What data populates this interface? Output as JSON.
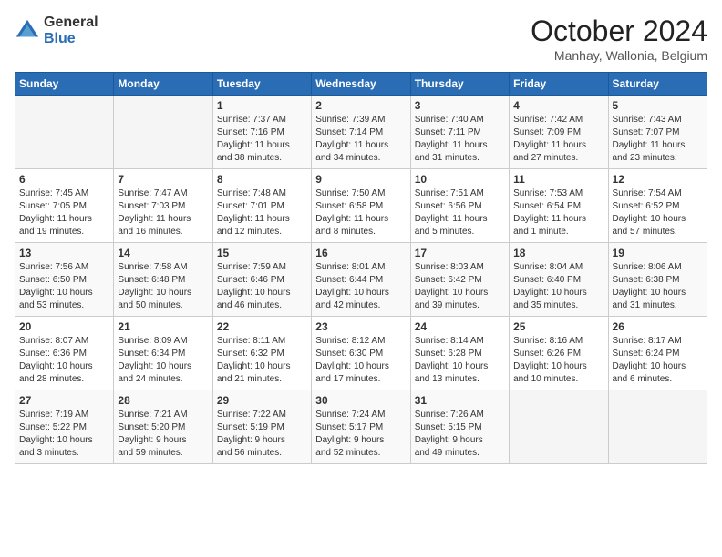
{
  "header": {
    "logo_general": "General",
    "logo_blue": "Blue",
    "title": "October 2024",
    "location": "Manhay, Wallonia, Belgium"
  },
  "days_of_week": [
    "Sunday",
    "Monday",
    "Tuesday",
    "Wednesday",
    "Thursday",
    "Friday",
    "Saturday"
  ],
  "weeks": [
    [
      {
        "day": "",
        "info": ""
      },
      {
        "day": "",
        "info": ""
      },
      {
        "day": "1",
        "info": "Sunrise: 7:37 AM\nSunset: 7:16 PM\nDaylight: 11 hours\nand 38 minutes."
      },
      {
        "day": "2",
        "info": "Sunrise: 7:39 AM\nSunset: 7:14 PM\nDaylight: 11 hours\nand 34 minutes."
      },
      {
        "day": "3",
        "info": "Sunrise: 7:40 AM\nSunset: 7:11 PM\nDaylight: 11 hours\nand 31 minutes."
      },
      {
        "day": "4",
        "info": "Sunrise: 7:42 AM\nSunset: 7:09 PM\nDaylight: 11 hours\nand 27 minutes."
      },
      {
        "day": "5",
        "info": "Sunrise: 7:43 AM\nSunset: 7:07 PM\nDaylight: 11 hours\nand 23 minutes."
      }
    ],
    [
      {
        "day": "6",
        "info": "Sunrise: 7:45 AM\nSunset: 7:05 PM\nDaylight: 11 hours\nand 19 minutes."
      },
      {
        "day": "7",
        "info": "Sunrise: 7:47 AM\nSunset: 7:03 PM\nDaylight: 11 hours\nand 16 minutes."
      },
      {
        "day": "8",
        "info": "Sunrise: 7:48 AM\nSunset: 7:01 PM\nDaylight: 11 hours\nand 12 minutes."
      },
      {
        "day": "9",
        "info": "Sunrise: 7:50 AM\nSunset: 6:58 PM\nDaylight: 11 hours\nand 8 minutes."
      },
      {
        "day": "10",
        "info": "Sunrise: 7:51 AM\nSunset: 6:56 PM\nDaylight: 11 hours\nand 5 minutes."
      },
      {
        "day": "11",
        "info": "Sunrise: 7:53 AM\nSunset: 6:54 PM\nDaylight: 11 hours\nand 1 minute."
      },
      {
        "day": "12",
        "info": "Sunrise: 7:54 AM\nSunset: 6:52 PM\nDaylight: 10 hours\nand 57 minutes."
      }
    ],
    [
      {
        "day": "13",
        "info": "Sunrise: 7:56 AM\nSunset: 6:50 PM\nDaylight: 10 hours\nand 53 minutes."
      },
      {
        "day": "14",
        "info": "Sunrise: 7:58 AM\nSunset: 6:48 PM\nDaylight: 10 hours\nand 50 minutes."
      },
      {
        "day": "15",
        "info": "Sunrise: 7:59 AM\nSunset: 6:46 PM\nDaylight: 10 hours\nand 46 minutes."
      },
      {
        "day": "16",
        "info": "Sunrise: 8:01 AM\nSunset: 6:44 PM\nDaylight: 10 hours\nand 42 minutes."
      },
      {
        "day": "17",
        "info": "Sunrise: 8:03 AM\nSunset: 6:42 PM\nDaylight: 10 hours\nand 39 minutes."
      },
      {
        "day": "18",
        "info": "Sunrise: 8:04 AM\nSunset: 6:40 PM\nDaylight: 10 hours\nand 35 minutes."
      },
      {
        "day": "19",
        "info": "Sunrise: 8:06 AM\nSunset: 6:38 PM\nDaylight: 10 hours\nand 31 minutes."
      }
    ],
    [
      {
        "day": "20",
        "info": "Sunrise: 8:07 AM\nSunset: 6:36 PM\nDaylight: 10 hours\nand 28 minutes."
      },
      {
        "day": "21",
        "info": "Sunrise: 8:09 AM\nSunset: 6:34 PM\nDaylight: 10 hours\nand 24 minutes."
      },
      {
        "day": "22",
        "info": "Sunrise: 8:11 AM\nSunset: 6:32 PM\nDaylight: 10 hours\nand 21 minutes."
      },
      {
        "day": "23",
        "info": "Sunrise: 8:12 AM\nSunset: 6:30 PM\nDaylight: 10 hours\nand 17 minutes."
      },
      {
        "day": "24",
        "info": "Sunrise: 8:14 AM\nSunset: 6:28 PM\nDaylight: 10 hours\nand 13 minutes."
      },
      {
        "day": "25",
        "info": "Sunrise: 8:16 AM\nSunset: 6:26 PM\nDaylight: 10 hours\nand 10 minutes."
      },
      {
        "day": "26",
        "info": "Sunrise: 8:17 AM\nSunset: 6:24 PM\nDaylight: 10 hours\nand 6 minutes."
      }
    ],
    [
      {
        "day": "27",
        "info": "Sunrise: 7:19 AM\nSunset: 5:22 PM\nDaylight: 10 hours\nand 3 minutes."
      },
      {
        "day": "28",
        "info": "Sunrise: 7:21 AM\nSunset: 5:20 PM\nDaylight: 9 hours\nand 59 minutes."
      },
      {
        "day": "29",
        "info": "Sunrise: 7:22 AM\nSunset: 5:19 PM\nDaylight: 9 hours\nand 56 minutes."
      },
      {
        "day": "30",
        "info": "Sunrise: 7:24 AM\nSunset: 5:17 PM\nDaylight: 9 hours\nand 52 minutes."
      },
      {
        "day": "31",
        "info": "Sunrise: 7:26 AM\nSunset: 5:15 PM\nDaylight: 9 hours\nand 49 minutes."
      },
      {
        "day": "",
        "info": ""
      },
      {
        "day": "",
        "info": ""
      }
    ]
  ]
}
